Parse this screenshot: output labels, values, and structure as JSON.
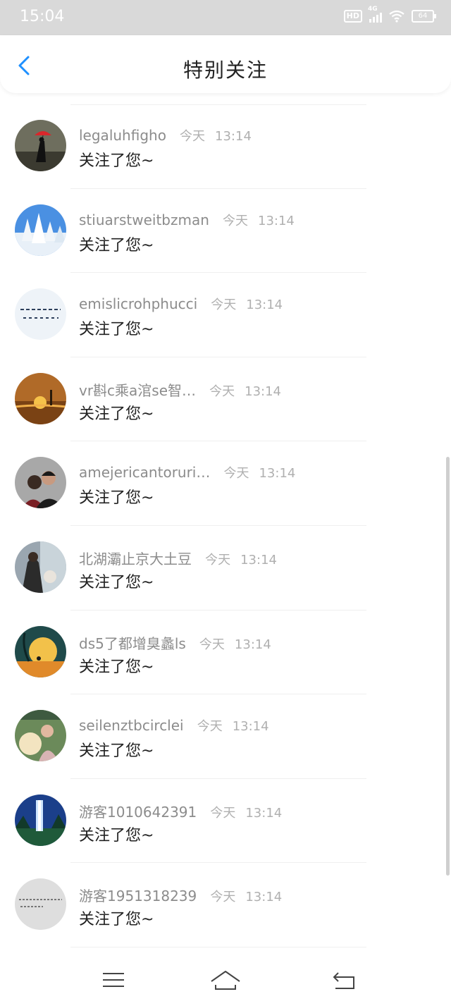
{
  "status_bar": {
    "time": "15:04",
    "hd": "HD",
    "network": "4G",
    "battery": "64"
  },
  "header": {
    "title": "特别关注"
  },
  "items": [
    {
      "username": "legaluhfigho",
      "day": "今天",
      "time": "13:14",
      "message": "关注了您~"
    },
    {
      "username": "stiuarstweitbzman",
      "day": "今天",
      "time": "13:14",
      "message": "关注了您~"
    },
    {
      "username": "emislicrohphucci",
      "day": "今天",
      "time": "13:14",
      "message": "关注了您~"
    },
    {
      "username": "vr斟c乘a涫se智…",
      "day": "今天",
      "time": "13:14",
      "message": "关注了您~"
    },
    {
      "username": "amejericantoruri…",
      "day": "今天",
      "time": "13:14",
      "message": "关注了您~"
    },
    {
      "username": "北湖灞止京大土豆",
      "day": "今天",
      "time": "13:14",
      "message": "关注了您~"
    },
    {
      "username": "ds5了都增臭蠡ls",
      "day": "今天",
      "time": "13:14",
      "message": "关注了您~"
    },
    {
      "username": "seilenztbcirclei",
      "day": "今天",
      "time": "13:14",
      "message": "关注了您~"
    },
    {
      "username": "游客1010642391",
      "day": "今天",
      "time": "13:14",
      "message": "关注了您~"
    },
    {
      "username": "游客1951318239",
      "day": "今天",
      "time": "13:14",
      "message": "关注了您~"
    }
  ],
  "colors": {
    "accent": "#1e90ff",
    "username": "#8c8c8c",
    "time": "#b0b0b0",
    "message": "#222222"
  },
  "icons": {
    "back": "chevron-left-icon",
    "menu": "menu-icon",
    "home": "home-icon",
    "return": "return-icon"
  }
}
